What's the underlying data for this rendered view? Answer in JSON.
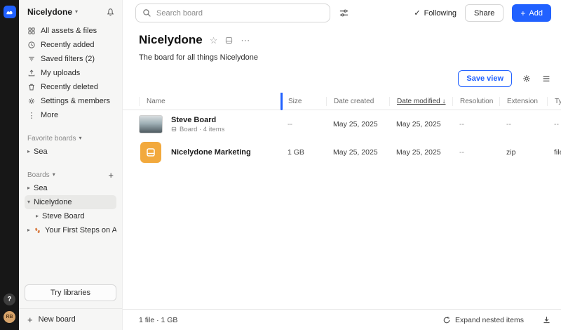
{
  "colors": {
    "accent": "#2161FF",
    "board_amber": "#F2A93D",
    "rail_bg": "#171717"
  },
  "glyphs": {
    "caret_down": "▾",
    "caret_right": "▸",
    "ellipsis_v": "⋮",
    "ellipsis_h": "⋯",
    "star": "☆",
    "check": "✓",
    "plus": "+",
    "sort_desc": "↓",
    "question": "?"
  },
  "rail": {
    "help_label": "?",
    "avatar_initials": "RB"
  },
  "sidebar": {
    "workspace": "Nicelydone",
    "menu": [
      {
        "label": "All assets & files",
        "icon": "grid-icon"
      },
      {
        "label": "Recently added",
        "icon": "clock-icon"
      },
      {
        "label": "Saved filters (2)",
        "icon": "filter-icon"
      },
      {
        "label": "My uploads",
        "icon": "upload-icon"
      },
      {
        "label": "Recently deleted",
        "icon": "trash-icon"
      },
      {
        "label": "Settings & members",
        "icon": "gear-icon"
      },
      {
        "label": "More",
        "icon": "ellipsis-icon"
      }
    ],
    "sections": {
      "favorites": "Favorite boards",
      "boards": "Boards"
    },
    "favorites": [
      {
        "label": "Sea"
      }
    ],
    "boards": [
      {
        "label": "Sea"
      },
      {
        "label": "Nicelydone",
        "selected": true,
        "expanded": true
      },
      {
        "label": "Steve Board",
        "child_of": "Nicelydone"
      },
      {
        "label": "Your First Steps on Air",
        "icon": "footsteps-icon"
      }
    ],
    "try_libraries": "Try libraries",
    "new_board": "New board"
  },
  "topbar": {
    "search_placeholder": "Search board",
    "following": "Following",
    "share": "Share",
    "add": "Add"
  },
  "board_header": {
    "title": "Nicelydone",
    "description": "The board for all things Nicelydone",
    "save_view": "Save view"
  },
  "table": {
    "columns": [
      "Name",
      "Size",
      "Date created",
      "Date modified",
      "Resolution",
      "Extension",
      "Type"
    ],
    "sort": {
      "column": "Date modified",
      "direction": "desc"
    },
    "rows": [
      {
        "name": "Steve Board",
        "subtitle": "Board · 4 items",
        "thumb": "image",
        "size": "--",
        "date_created": "May 25, 2025",
        "date_modified": "May 25, 2025",
        "resolution": "--",
        "extension": "--",
        "type": "--"
      },
      {
        "name": "Nicelydone Marketing",
        "subtitle": "",
        "thumb": "board",
        "size": "1 GB",
        "date_created": "May 25, 2025",
        "date_modified": "May 25, 2025",
        "resolution": "--",
        "extension": "zip",
        "type": "file"
      }
    ]
  },
  "footer": {
    "summary": "1 file · 1 GB",
    "expand_nested": "Expand nested items"
  }
}
